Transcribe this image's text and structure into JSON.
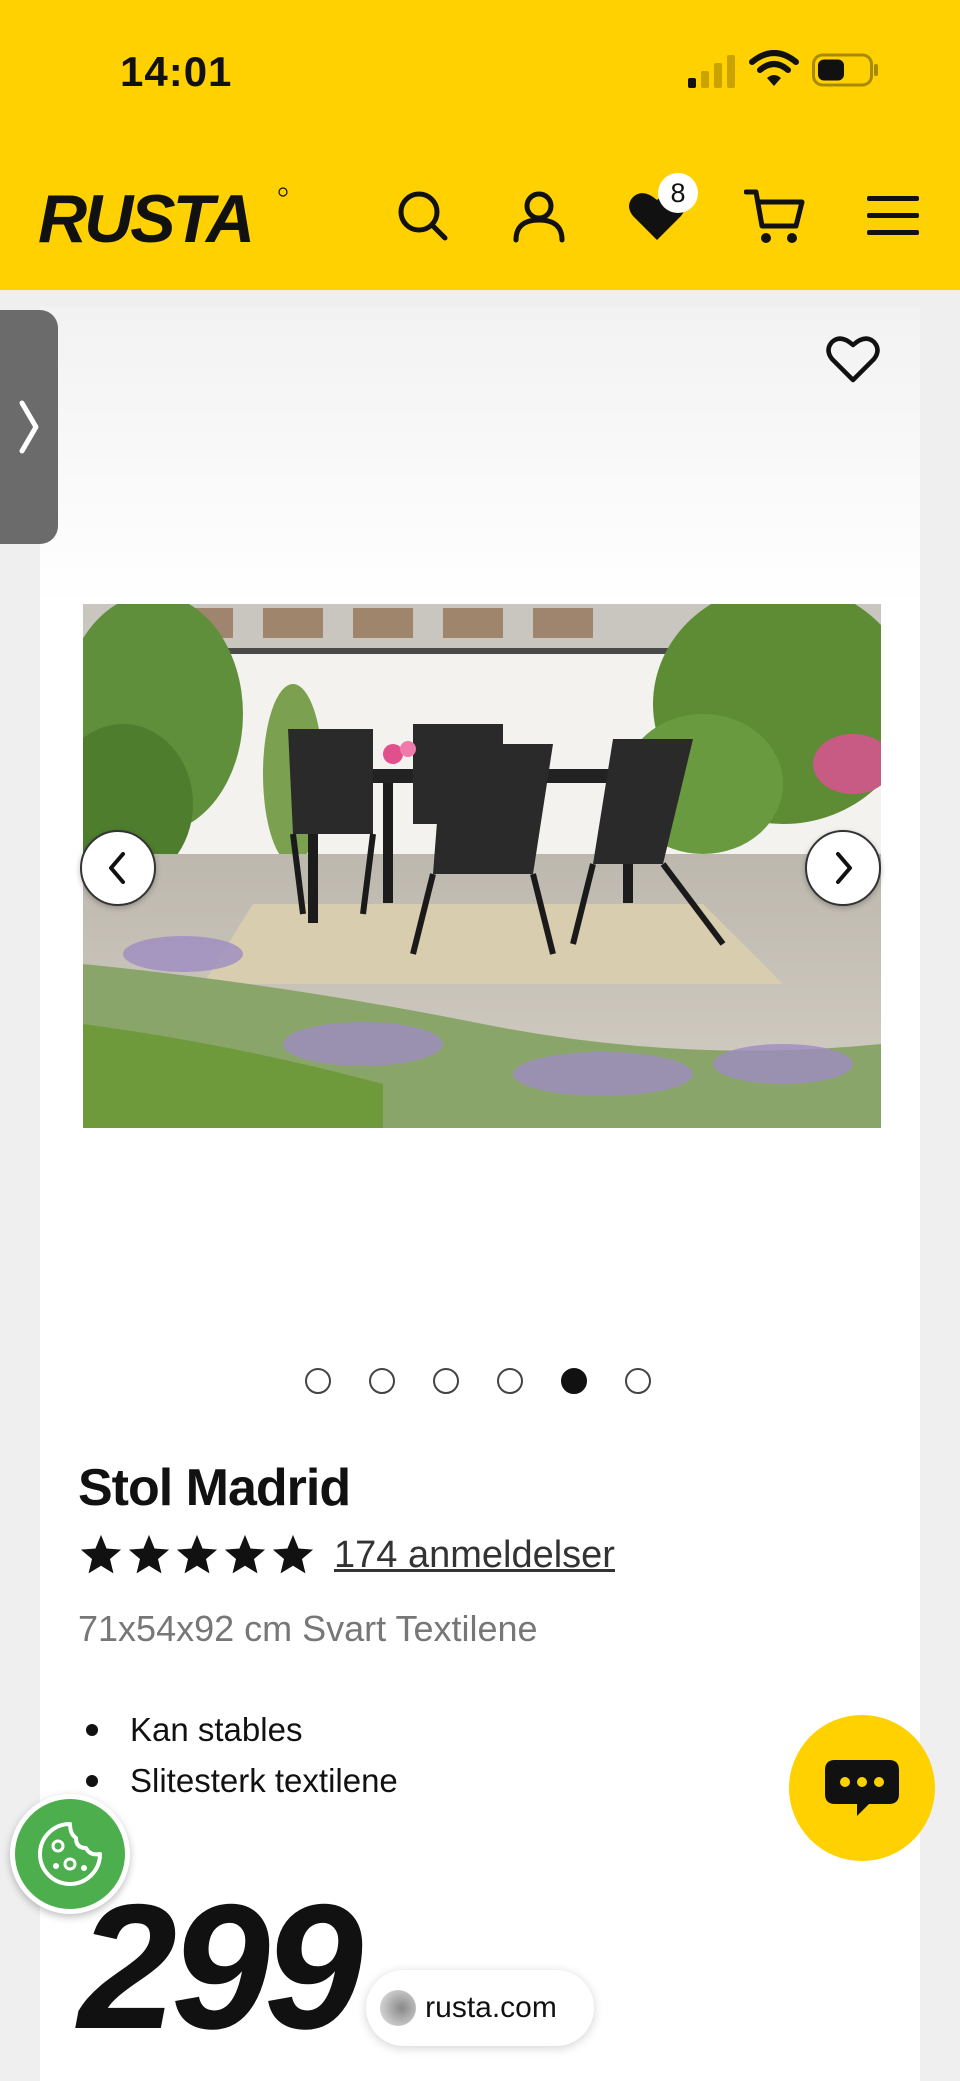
{
  "status_bar": {
    "time": "14:01"
  },
  "header": {
    "brand": "RUSTA",
    "wishlist_count": "8",
    "colors": {
      "brand_yellow": "#ffd100",
      "text": "#111111"
    }
  },
  "gallery": {
    "image_alt": "Stol Madrid garden set",
    "dot_count": 6,
    "active_index": 4
  },
  "product": {
    "title": "Stol Madrid",
    "rating": 5,
    "reviews": "174 anmeldelser",
    "subtitle": "71x54x92 cm Svart Textilene",
    "features": [
      "Kan stables",
      "Slitesterk textilene"
    ],
    "price": "299"
  },
  "browser": {
    "url": "rusta.com"
  }
}
